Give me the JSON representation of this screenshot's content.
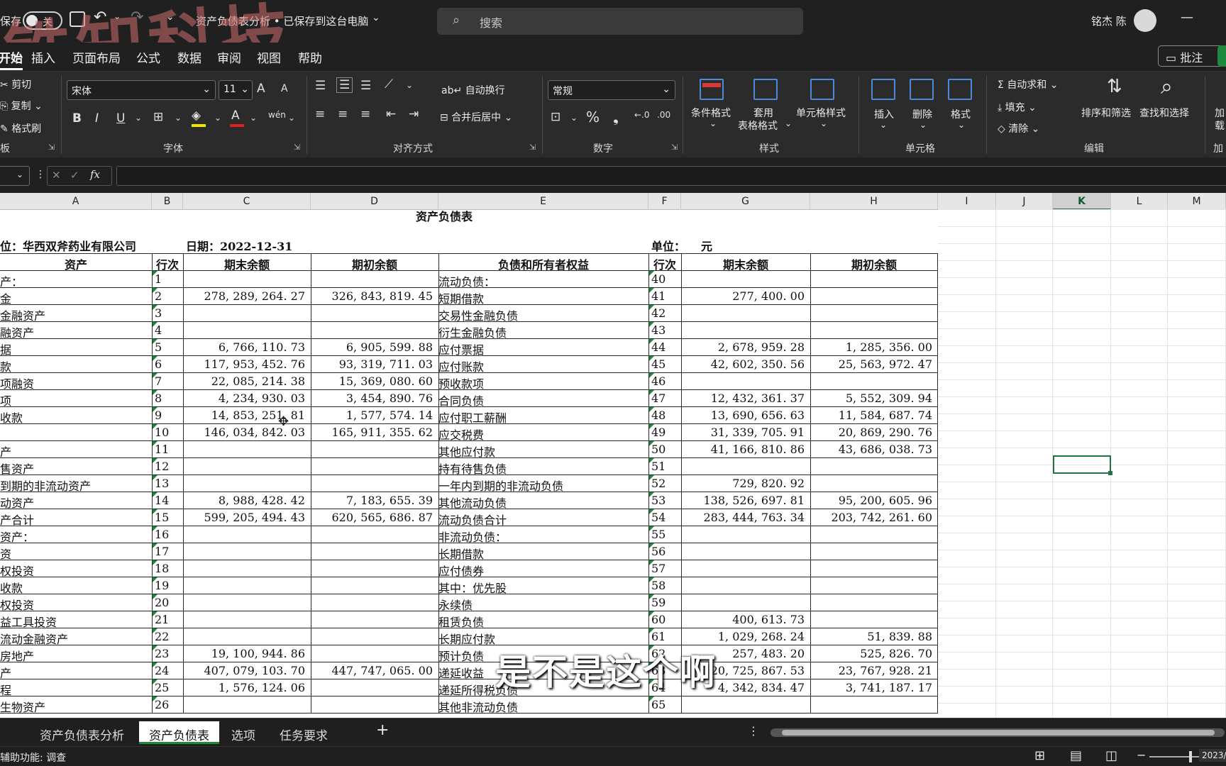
{
  "titlebar": {
    "autosave_label": "保存",
    "toggle_label": "关",
    "doc_title": "资产负债表分析 • 已保存到这台电脑",
    "search_placeholder": "搜索",
    "user_name": "铭杰 陈"
  },
  "watermark": "铁知科技",
  "menu": {
    "items": [
      "开始",
      "插入",
      "页面布局",
      "公式",
      "数据",
      "审阅",
      "视图",
      "帮助"
    ],
    "active": "开始",
    "comment_button": "批注"
  },
  "ribbon": {
    "clipboard": {
      "cut": "剪切",
      "copy": "复制",
      "format_painter": "格式刷",
      "group": "剪贴板"
    },
    "font": {
      "family": "宋体",
      "size": "11",
      "group": "字体"
    },
    "alignment": {
      "wrap": "自动换行",
      "merge": "合并后居中",
      "group": "对齐方式"
    },
    "number": {
      "format": "常规",
      "group": "数字"
    },
    "styles": {
      "conditional": "条件格式",
      "table_format_1": "套用",
      "table_format_2": "表格格式",
      "cell_styles": "单元格样式",
      "group": "样式"
    },
    "cells": {
      "insert": "插入",
      "delete": "删除",
      "format": "格式",
      "group": "单元格"
    },
    "editing": {
      "autosum": "自动求和",
      "fill": "填充",
      "clear": "清除",
      "sort": "排序和筛选",
      "find": "查找和选择",
      "group": "编辑"
    },
    "addins": {
      "label1": "加",
      "label2": "载",
      "group": "加载"
    }
  },
  "formula_bar": {
    "fx": "fx",
    "value": ""
  },
  "columns": [
    "A",
    "B",
    "C",
    "D",
    "E",
    "F",
    "G",
    "H",
    "I",
    "J",
    "K",
    "L",
    "M"
  ],
  "selected_column": "K",
  "sheet": {
    "title_partial": "资产负债表",
    "company": "位：华西双斧药业有限公司",
    "date": "日期：2022-12-31",
    "unit_label": "单位：",
    "unit_value": "元",
    "headers": [
      "资产",
      "行次",
      "期末余额",
      "期初余额",
      "负债和所有者权益",
      "行次",
      "期末余额",
      "期初余额"
    ],
    "rows": [
      [
        "产：",
        "1",
        "",
        "",
        "流动负债：",
        "40",
        "",
        ""
      ],
      [
        "金",
        "2",
        "278, 289, 264. 27",
        "326, 843, 819. 45",
        "短期借款",
        "41",
        "277, 400. 00",
        ""
      ],
      [
        "金融资产",
        "3",
        "",
        "",
        "交易性金融负债",
        "42",
        "",
        ""
      ],
      [
        "融资产",
        "4",
        "",
        "",
        "衍生金融负债",
        "43",
        "",
        ""
      ],
      [
        "据",
        "5",
        "6, 766, 110. 73",
        "6, 905, 599. 88",
        "应付票据",
        "44",
        "2, 678, 959. 28",
        "1, 285, 356. 00"
      ],
      [
        "款",
        "6",
        "117, 953, 452. 76",
        "93, 319, 711. 03",
        "应付账款",
        "45",
        "42, 602, 350. 56",
        "25, 563, 972. 47"
      ],
      [
        "项融资",
        "7",
        "22, 085, 214. 38",
        "15, 369, 080. 60",
        "预收款项",
        "46",
        "",
        ""
      ],
      [
        "项",
        "8",
        "4, 234, 930. 03",
        "3, 454, 890. 76",
        "合同负债",
        "47",
        "12, 432, 361. 37",
        "5, 552, 309. 94"
      ],
      [
        "收款",
        "9",
        "14, 853, 251. 81",
        "1, 577, 574. 14",
        "应付职工薪酬",
        "48",
        "13, 690, 656. 63",
        "11, 584, 687. 74"
      ],
      [
        "",
        "10",
        "146, 034, 842. 03",
        "165, 911, 355. 62",
        "应交税费",
        "49",
        "31, 339, 705. 91",
        "20, 869, 290. 76"
      ],
      [
        "产",
        "11",
        "",
        "",
        "其他应付款",
        "50",
        "41, 166, 810. 86",
        "43, 686, 038. 73"
      ],
      [
        "售资产",
        "12",
        "",
        "",
        "持有待售负债",
        "51",
        "",
        ""
      ],
      [
        "到期的非流动资产",
        "13",
        "",
        "",
        "一年内到期的非流动负债",
        "52",
        "729, 820. 92",
        ""
      ],
      [
        "动资产",
        "14",
        "8, 988, 428. 42",
        "7, 183, 655. 39",
        "其他流动负债",
        "53",
        "138, 526, 697. 81",
        "95, 200, 605. 96"
      ],
      [
        "产合计",
        "15",
        "599, 205, 494. 43",
        "620, 565, 686. 87",
        "流动负债合计",
        "54",
        "283, 444, 763. 34",
        "203, 742, 261. 60"
      ],
      [
        "资产：",
        "16",
        "",
        "",
        "非流动负债：",
        "55",
        "",
        ""
      ],
      [
        "资",
        "17",
        "",
        "",
        "长期借款",
        "56",
        "",
        ""
      ],
      [
        "权投资",
        "18",
        "",
        "",
        "应付债券",
        "57",
        "",
        ""
      ],
      [
        "收款",
        "19",
        "",
        "",
        "其中：优先股",
        "58",
        "",
        ""
      ],
      [
        "权投资",
        "20",
        "",
        "",
        "永续债",
        "59",
        "",
        ""
      ],
      [
        "益工具投资",
        "21",
        "",
        "",
        "租赁负债",
        "60",
        "400, 613. 73",
        ""
      ],
      [
        "流动金融资产",
        "22",
        "",
        "",
        "长期应付款",
        "61",
        "1, 029, 268. 24",
        "51, 839. 88"
      ],
      [
        "房地产",
        "23",
        "19, 100, 944. 86",
        "",
        "预计负债",
        "62",
        "257, 483. 20",
        "525, 826. 70"
      ],
      [
        "产",
        "24",
        "407, 079, 103. 70",
        "447, 747, 065. 00",
        "递延收益",
        "63",
        "20, 725, 867. 53",
        "23, 767, 928. 21"
      ],
      [
        "程",
        "25",
        "1, 576, 124. 06",
        "",
        "递延所得税负债",
        "64",
        "4, 342, 834. 47",
        "3, 741, 187. 17"
      ],
      [
        "生物资产",
        "26",
        "",
        "",
        "其他非流动负债",
        "65",
        "",
        ""
      ]
    ]
  },
  "sheet_tabs": [
    "资产负债表分析",
    "资产负债表",
    "选项",
    "任务要求"
  ],
  "active_tab": "资产负债表",
  "add_sheet": "+",
  "status": {
    "accessibility": "辅助功能: 调查",
    "date_partial": "2023/"
  },
  "subtitle": "是不是这个啊"
}
